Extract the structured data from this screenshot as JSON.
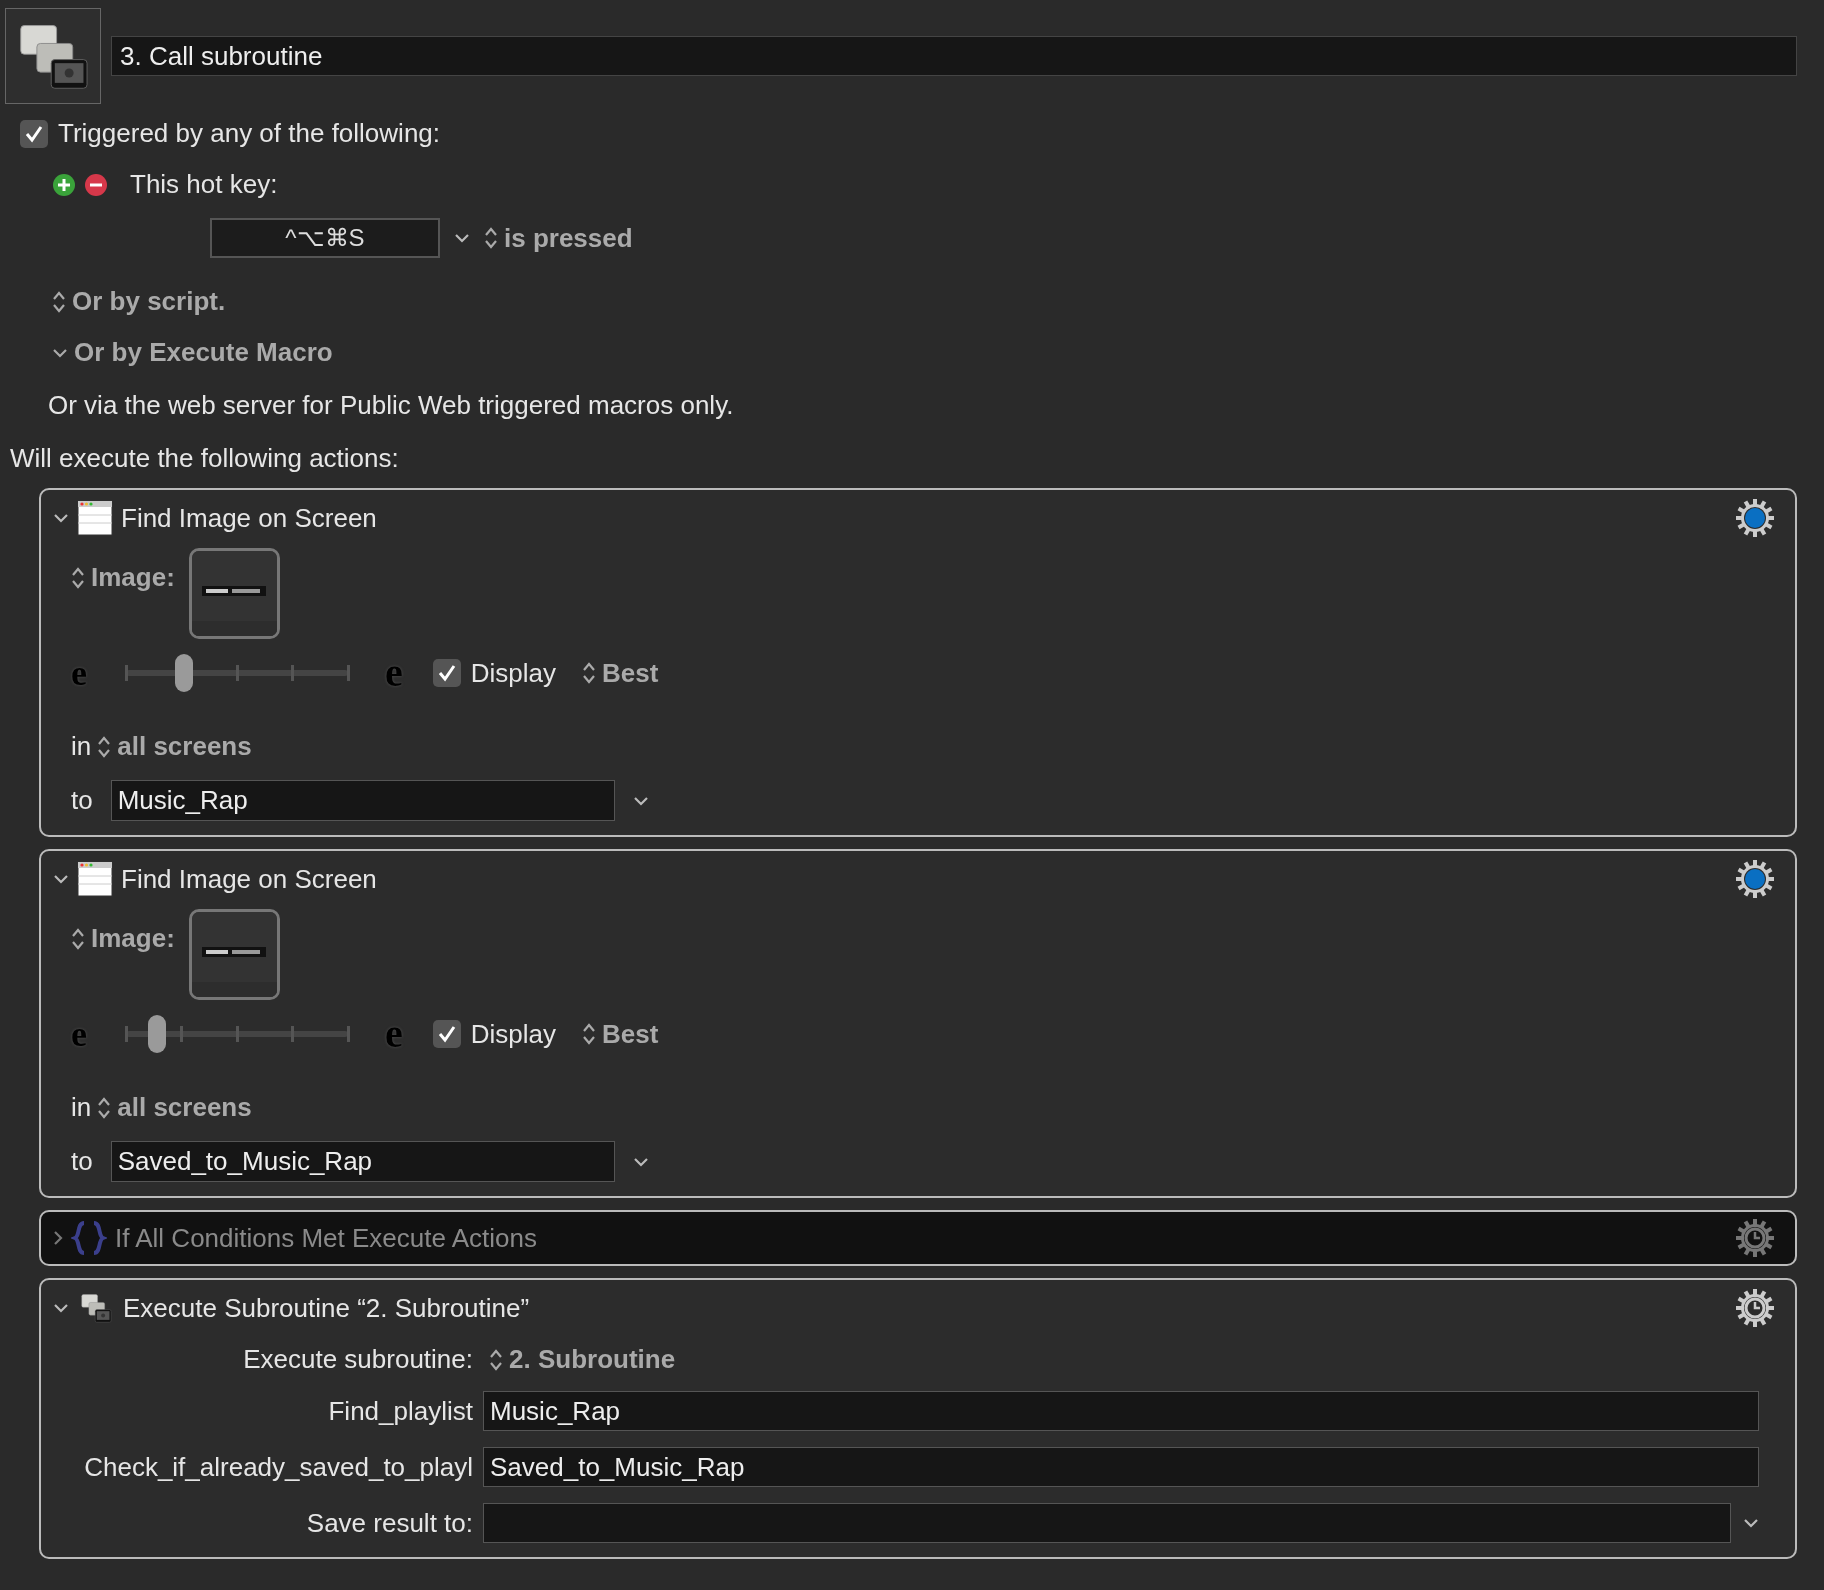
{
  "macro": {
    "title": "3. Call subroutine"
  },
  "trigger": {
    "checked": true,
    "label": "Triggered by any of the following:"
  },
  "hot_key": {
    "label": "This hot key:",
    "keys": "^⌥⌘S",
    "condition": "is pressed"
  },
  "trigger_options": [
    {
      "kind": "popup",
      "label": "Or by script."
    },
    {
      "kind": "disclosure",
      "label": "Or by Execute Macro"
    }
  ],
  "web_note": "Or via the web server for Public Web triggered macros only.",
  "actions_heading": "Will execute the following actions:",
  "actions": [
    {
      "kind": "find_image",
      "title": "Find Image on Screen",
      "expanded": true,
      "enabled": true,
      "clock_badge": false,
      "image_label": "Image:",
      "slider_min": "e",
      "slider_max": "e",
      "level": 0.26,
      "display_checked": true,
      "display_label": "Display",
      "mode": "Best",
      "in_label": "in",
      "screens": "all screens",
      "to_label": "to",
      "variable": "Music_Rap"
    },
    {
      "kind": "find_image",
      "title": "Find Image on Screen",
      "expanded": true,
      "enabled": true,
      "clock_badge": false,
      "image_label": "Image:",
      "slider_min": "e",
      "slider_max": "e",
      "level": 0.14,
      "display_checked": true,
      "display_label": "Display",
      "mode": "Best",
      "in_label": "in",
      "screens": "all screens",
      "to_label": "to",
      "variable": "Saved_to_Music_Rap"
    },
    {
      "kind": "if_conditions",
      "title": "If All Conditions Met Execute Actions",
      "expanded": false,
      "enabled": false,
      "clock_badge": true
    },
    {
      "kind": "execute_subroutine",
      "title": "Execute Subroutine “2. Subroutine”",
      "expanded": true,
      "enabled": true,
      "clock_badge": true,
      "subroutine_label": "Execute subroutine:",
      "subroutine": "2. Subroutine",
      "parameters": [
        {
          "name": "Find_playlist",
          "value": "Music_Rap"
        },
        {
          "name": "Check_if_already_saved_to_playl",
          "value": "Saved_to_Music_Rap"
        }
      ],
      "result_label": "Save result to:"
    }
  ]
}
